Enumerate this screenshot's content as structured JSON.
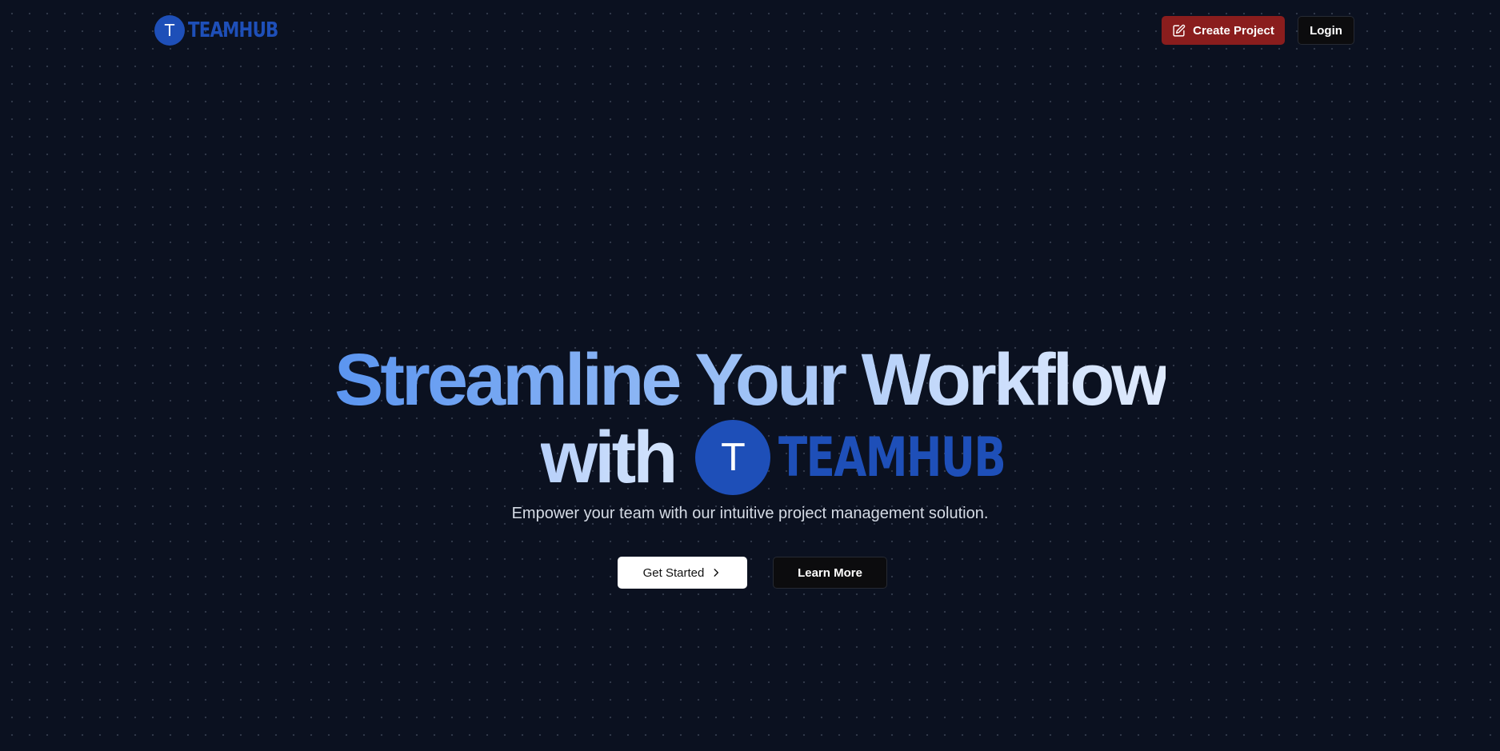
{
  "header": {
    "brand": {
      "initial": "T",
      "name": "TEAMHUB"
    },
    "create_label": "Create Project",
    "login_label": "Login"
  },
  "hero": {
    "headline_line1": "Streamline Your Workflow",
    "headline_with": "with",
    "logo_initial": "T",
    "logo_name": "TEAMHUB",
    "subtitle": "Empower your team with our intuitive project management solution.",
    "get_started_label": "Get Started",
    "learn_more_label": "Learn More"
  },
  "icons": {
    "create": "edit-square-icon",
    "get_started": "chevron-right-icon"
  },
  "colors": {
    "background": "#0b1120",
    "brand_blue": "#1e4fb8",
    "create_button": "#8a1d1d",
    "gradient_start": "#5b95f0",
    "gradient_end": "#dfeafd"
  }
}
